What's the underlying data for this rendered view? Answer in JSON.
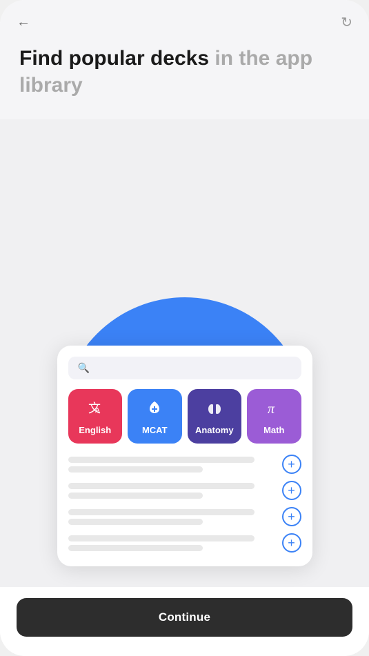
{
  "header": {
    "title_bold": "Find popular decks ",
    "title_gray": "in the app library"
  },
  "navigation": {
    "back_label": "←",
    "refresh_label": "↻"
  },
  "search": {
    "placeholder": ""
  },
  "categories": [
    {
      "id": "english",
      "label": "English",
      "icon": "✕",
      "icon_unicode": "🔤",
      "color_class": "english"
    },
    {
      "id": "mcat",
      "label": "MCAT",
      "icon": "⚕",
      "color_class": "mcat"
    },
    {
      "id": "anatomy",
      "label": "Anatomy",
      "icon": "🫁",
      "color_class": "anatomy"
    },
    {
      "id": "math",
      "label": "Math",
      "icon": "π",
      "color_class": "math"
    }
  ],
  "list_rows": [
    {
      "line1": "long",
      "line2": "short"
    },
    {
      "line1": "long",
      "line2": "short"
    },
    {
      "line1": "long",
      "line2": "short"
    },
    {
      "line1": "long",
      "line2": "short"
    }
  ],
  "add_button_label": "+",
  "continue": {
    "label": "Continue"
  }
}
